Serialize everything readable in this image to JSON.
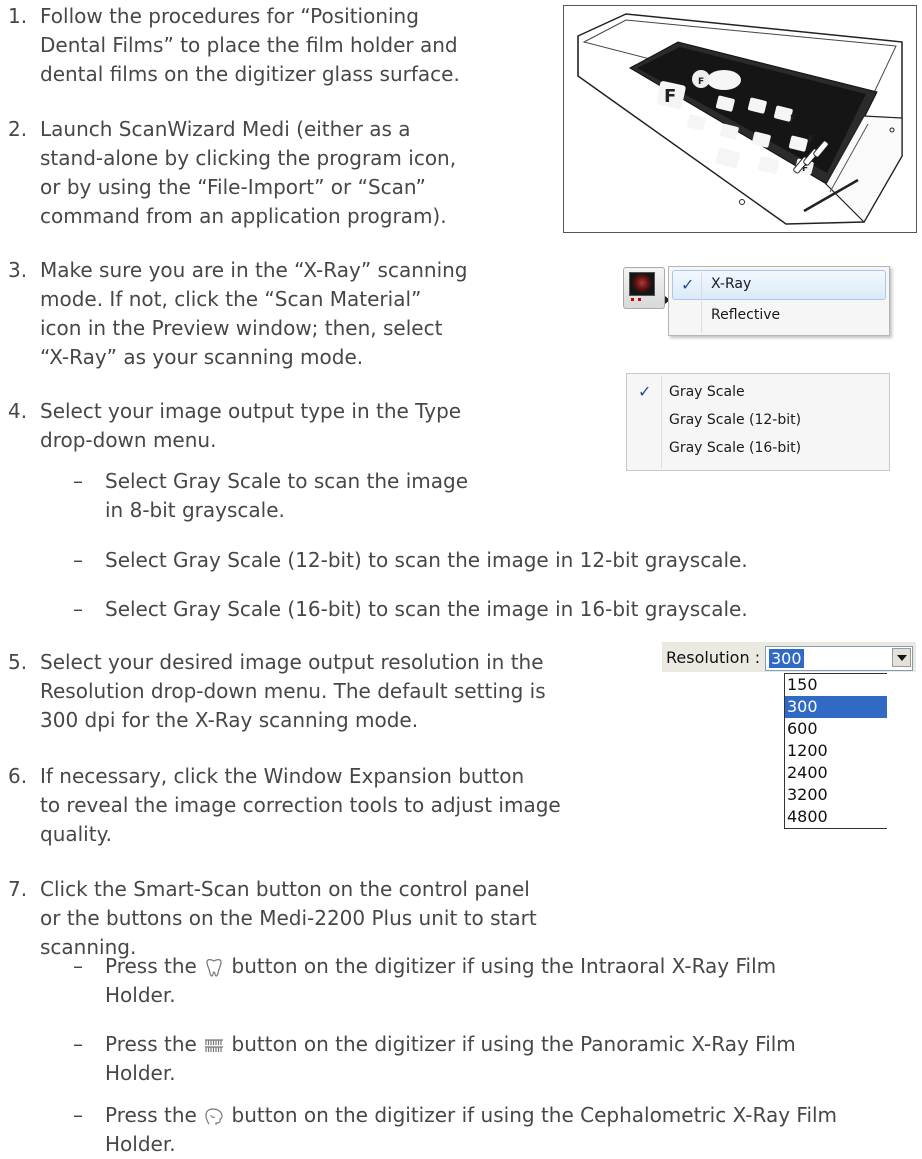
{
  "steps": [
    {
      "num": "1.",
      "lines": [
        "Follow the procedures for “Positioning",
        "Dental Films” to place the film holder and",
        "dental films on the digitizer glass surface."
      ]
    },
    {
      "num": "2.",
      "lines": [
        "Launch ScanWizard Medi (either as a",
        "stand-alone by clicking the program icon,",
        "or by using the “File-Import” or “Scan”",
        "command from an application program)."
      ]
    },
    {
      "num": "3.",
      "lines": [
        "Make sure you are in the “X-Ray” scanning",
        "mode. If not, click the “Scan Material”",
        "icon in the Preview window; then, select",
        "“X-Ray” as your scanning mode."
      ]
    },
    {
      "num": "4.",
      "lines": [
        "Select your image output type in the Type",
        "drop-down menu."
      ]
    },
    {
      "num": "5.",
      "lines": [
        "Select your desired image output resolution in the",
        "Resolution drop-down menu. The default setting is",
        "300 dpi for the X-Ray scanning mode."
      ]
    },
    {
      "num": "6.",
      "lines": [
        "If necessary, click the Window Expansion button",
        "to reveal the image correction tools to adjust image",
        "quality."
      ]
    },
    {
      "num": "7.",
      "lines": [
        "Click the Smart-Scan button on the control panel",
        "or the buttons on the Medi-2200 Plus unit to start",
        "scanning."
      ]
    }
  ],
  "sub4": [
    {
      "dash": "–",
      "lines": [
        "Select Gray Scale to scan the image",
        "in 8-bit grayscale."
      ]
    },
    {
      "dash": "–",
      "lines": [
        "Select Gray Scale (12-bit) to scan the image in 12-bit grayscale."
      ]
    },
    {
      "dash": "–",
      "lines": [
        "Select Gray Scale (16-bit) to scan the image in 16-bit grayscale."
      ]
    }
  ],
  "sub7": [
    {
      "dash": "–",
      "before": "Press the ",
      "after": " button on the digitizer if using the Intraoral X-Ray Film",
      "line2": "Holder.",
      "icon": "tooth-icon"
    },
    {
      "dash": "–",
      "before": "Press the ",
      "after": " button on the digitizer if using the Panoramic X-Ray Film",
      "line2": "Holder.",
      "icon": "teeth-row-icon"
    },
    {
      "dash": "–",
      "before": "Press the ",
      "after": " button on the digitizer if using the Cephalometric X-Ray Film",
      "line2": "Holder.",
      "icon": "head-profile-icon"
    }
  ],
  "scan_material_menu": {
    "items": [
      "X-Ray",
      "Reflective"
    ],
    "checked": "X-Ray",
    "check_mark": "✓"
  },
  "type_menu": {
    "items": [
      "Gray Scale",
      "Gray Scale (12-bit)",
      "Gray Scale (16-bit)"
    ],
    "checked": "Gray Scale",
    "check_mark": "✓"
  },
  "resolution": {
    "label": "Resolution :",
    "value": "300",
    "options": [
      "150",
      "300",
      "600",
      "1200",
      "2400",
      "3200",
      "4800"
    ],
    "selected": "300"
  },
  "scanner_film_letters": [
    "F",
    "F",
    "F",
    "F",
    "F"
  ],
  "colors": {
    "highlight": "#316ac5",
    "text": "#474747"
  }
}
